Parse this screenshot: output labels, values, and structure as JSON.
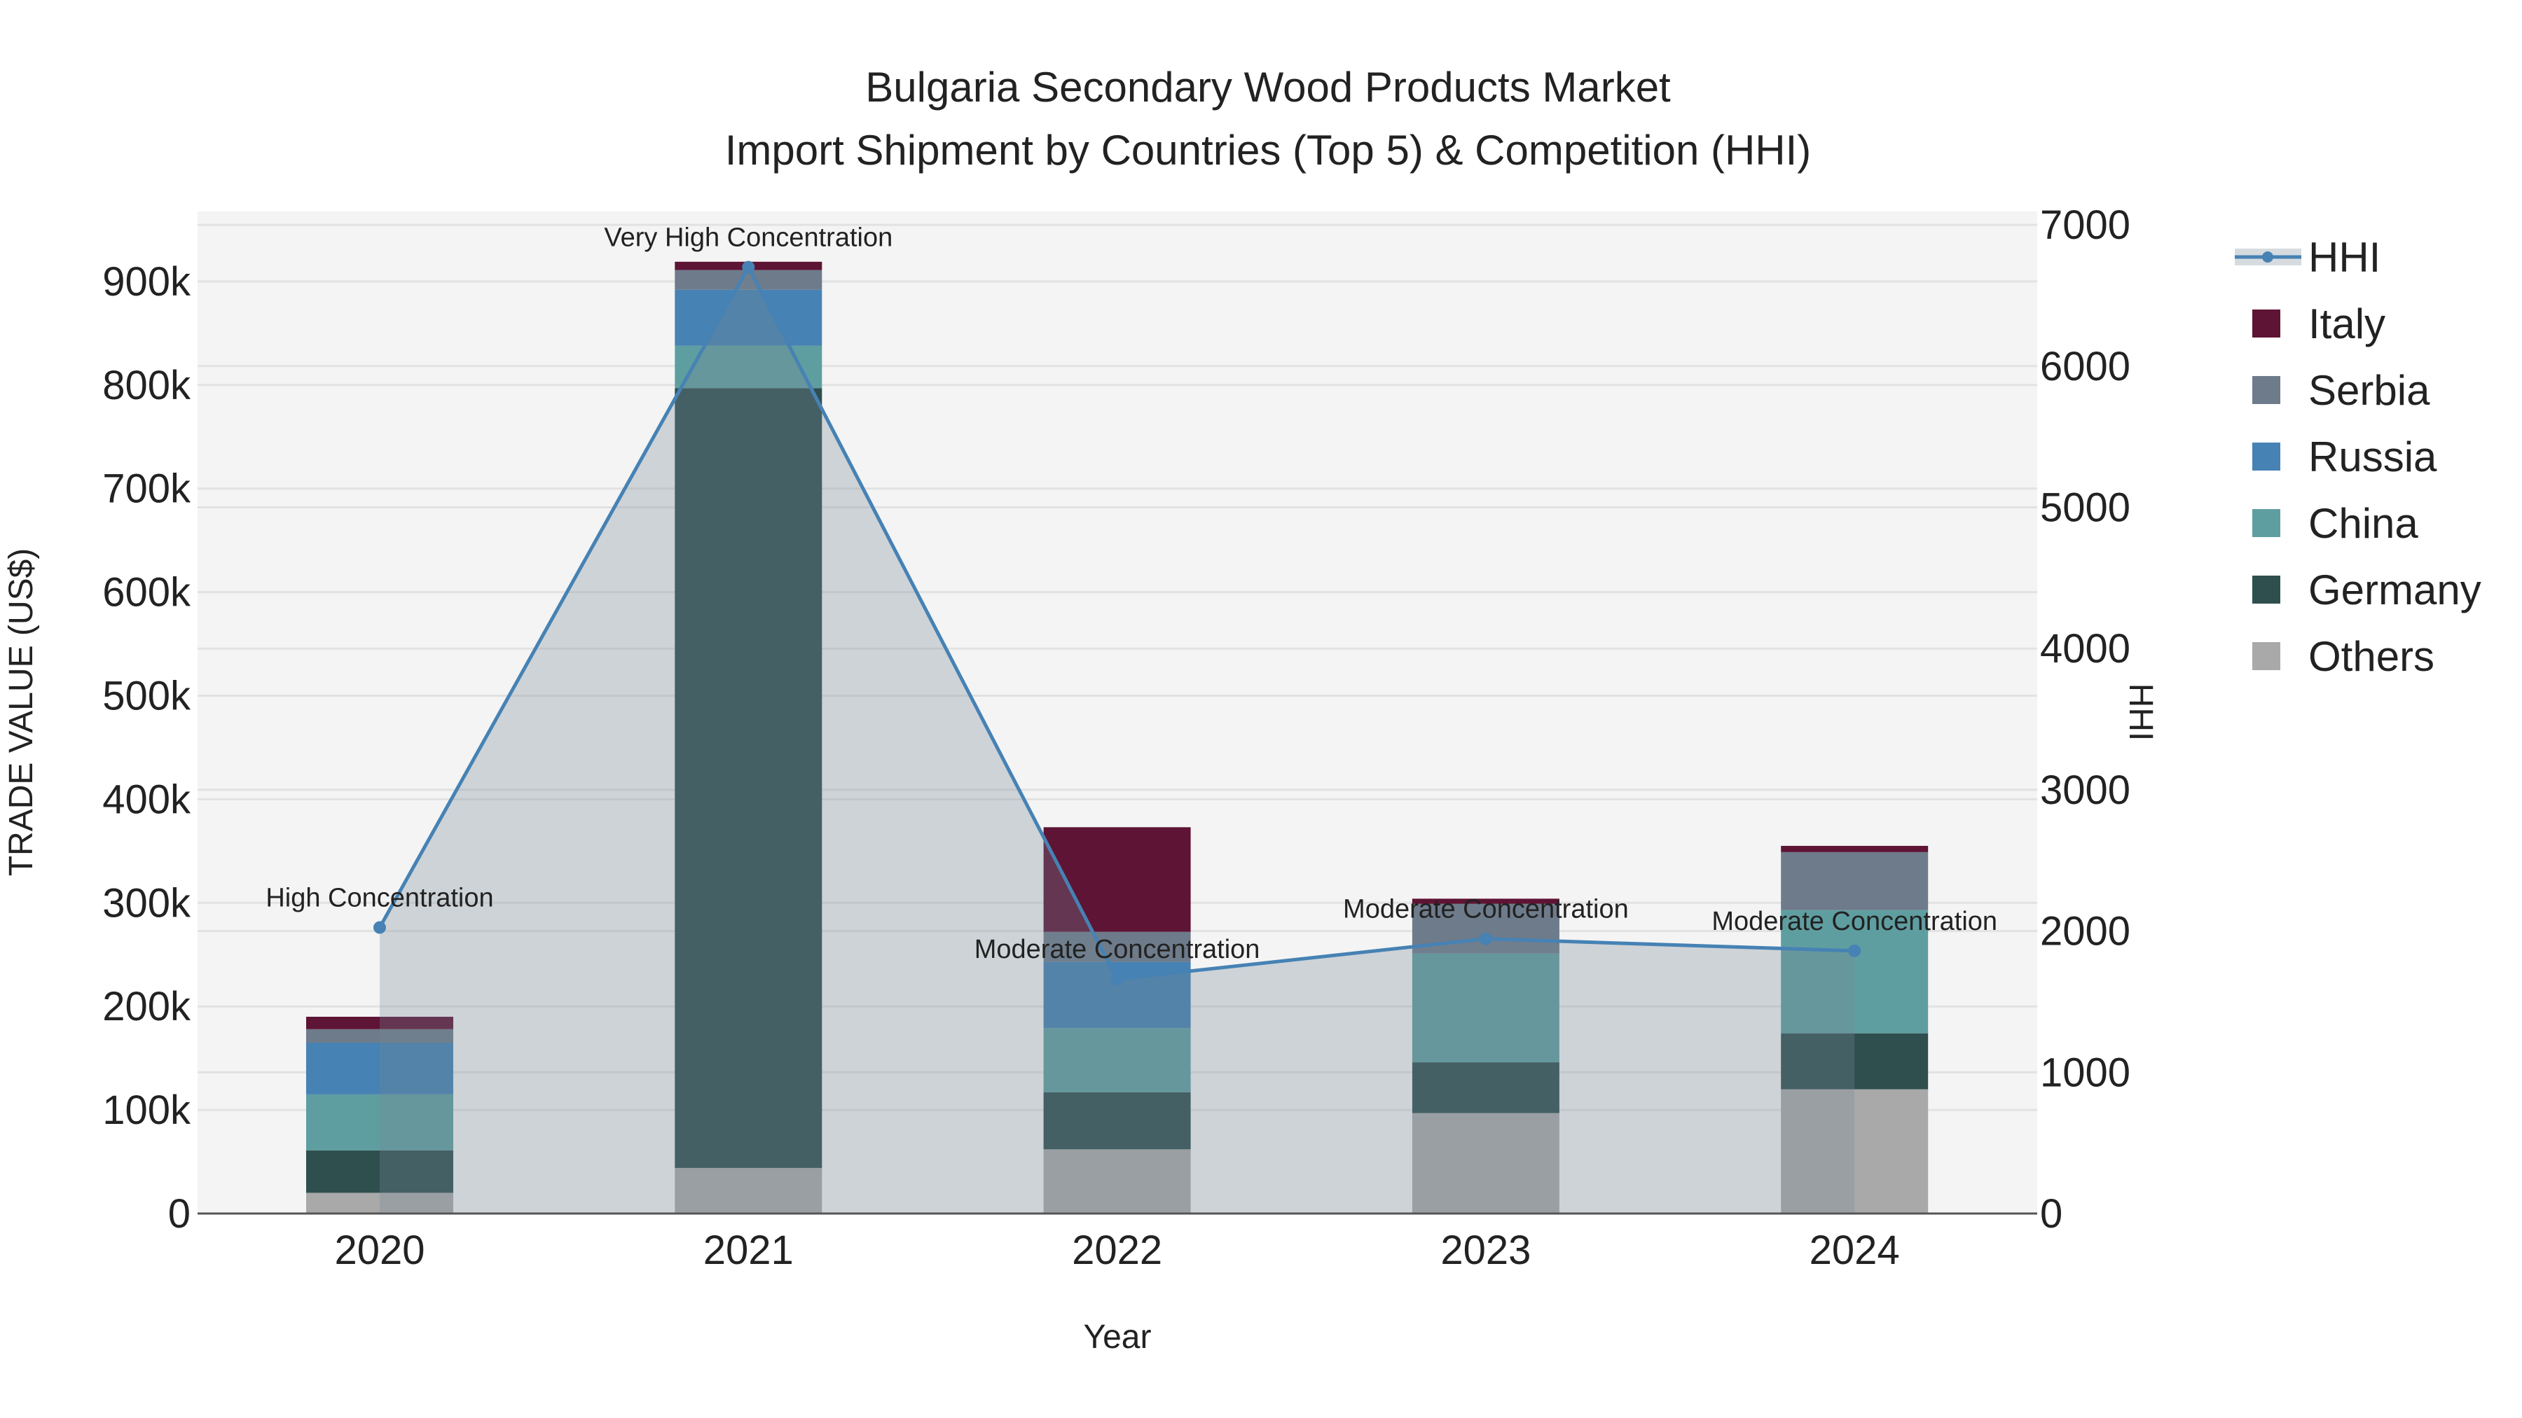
{
  "chart_data": {
    "type": "bar",
    "title": "Bulgaria Secondary Wood Products Market",
    "subtitle": "Import Shipment by Countries (Top 5) & Competition (HHI)",
    "xlabel": "Year",
    "ylabel": "TRADE VALUE (US$)",
    "y2label": "HHI",
    "categories": [
      "2020",
      "2021",
      "2022",
      "2023",
      "2024"
    ],
    "ylim": [
      0,
      960000
    ],
    "y2lim": [
      0,
      7100
    ],
    "yticks": [
      0,
      100000,
      200000,
      300000,
      400000,
      500000,
      600000,
      700000,
      800000,
      900000
    ],
    "ytick_labels": [
      "0",
      "100k",
      "200k",
      "300k",
      "400k",
      "500k",
      "600k",
      "700k",
      "800k",
      "900k"
    ],
    "y2ticks": [
      0,
      1000,
      2000,
      3000,
      4000,
      5000,
      6000,
      7000
    ],
    "y2tick_labels": [
      "0",
      "1000",
      "2000",
      "3000",
      "4000",
      "5000",
      "6000",
      "7000"
    ],
    "stacking": "stacked",
    "grid": true,
    "legend_position": "right",
    "series": [
      {
        "name": "Others",
        "color": "#a9a9a9",
        "values": [
          20000,
          44000,
          62000,
          97000,
          120000
        ]
      },
      {
        "name": "Germany",
        "color": "#2f4f4f",
        "values": [
          41000,
          753000,
          55000,
          49000,
          54000
        ]
      },
      {
        "name": "China",
        "color": "#5f9ea0",
        "values": [
          54000,
          41000,
          62000,
          105000,
          119000
        ]
      },
      {
        "name": "Russia",
        "color": "#4682b4",
        "values": [
          50000,
          54000,
          64000,
          0,
          0
        ]
      },
      {
        "name": "Serbia",
        "color": "#6e7b8b",
        "values": [
          13000,
          19000,
          29000,
          48000,
          56000
        ]
      },
      {
        "name": "Italy",
        "color": "#5e1434",
        "values": [
          12000,
          8000,
          101000,
          5000,
          6000
        ]
      }
    ],
    "hhi": {
      "name": "HHI",
      "color": "#4682b4",
      "values": [
        2025,
        6700,
        1660,
        1945,
        1860
      ],
      "annotations": [
        "High Concentration",
        "Very High Concentration",
        "Moderate Concentration",
        "Moderate Concentration",
        "Moderate Concentration"
      ]
    },
    "legend": [
      "HHI",
      "Italy",
      "Serbia",
      "Russia",
      "China",
      "Germany",
      "Others"
    ]
  }
}
